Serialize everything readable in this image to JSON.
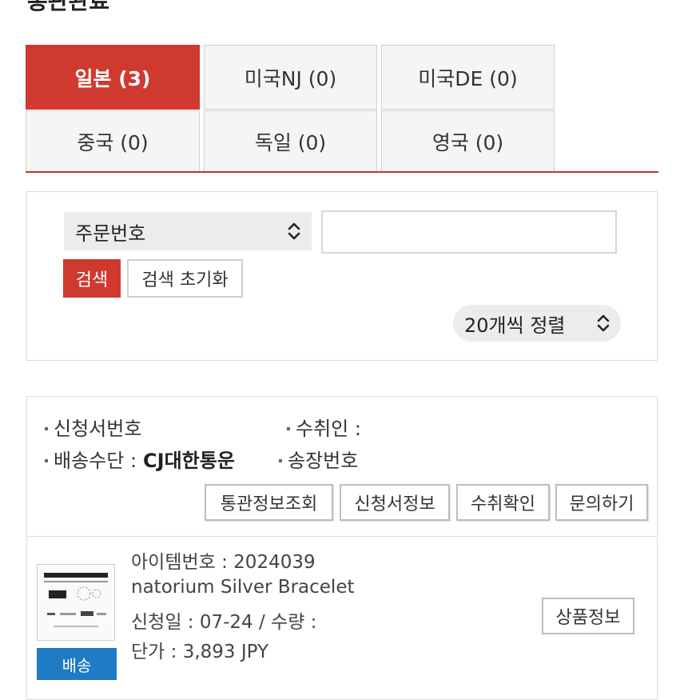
{
  "page_title": "통관완료",
  "tabs": [
    {
      "label": "일본 (3)",
      "active": true
    },
    {
      "label": "미국NJ (0)",
      "active": false
    },
    {
      "label": "미국DE (0)",
      "active": false
    },
    {
      "label": "중국 (0)",
      "active": false
    },
    {
      "label": "독일 (0)",
      "active": false
    },
    {
      "label": "영국 (0)",
      "active": false
    }
  ],
  "search": {
    "field_select": "주문번호",
    "query_value": "",
    "search_label": "검색",
    "reset_label": "검색 초기화",
    "sort_label": "20개씩 정렬"
  },
  "order": {
    "application_no_label": "신청서번호",
    "receiver_label": "수취인 :",
    "shipping_method_label": "배송수단 :",
    "shipping_method_value": "CJ대한통운",
    "tracking_label": "송장번호",
    "buttons": {
      "customs": "통관정보조회",
      "application": "신청서정보",
      "receipt": "수취확인",
      "inquiry": "문의하기"
    },
    "item": {
      "item_no": "아이템번호 : 2024039",
      "name": "natorium Silver Bracelet",
      "date_qty": "신청일 : 07-24 / 수량 :",
      "price": "단가 : 3,893 JPY",
      "ship_label": "배송",
      "product_info_label": "상품정보"
    }
  },
  "colors": {
    "accent_red": "#d0392f",
    "ship_blue": "#1e7bc4"
  }
}
